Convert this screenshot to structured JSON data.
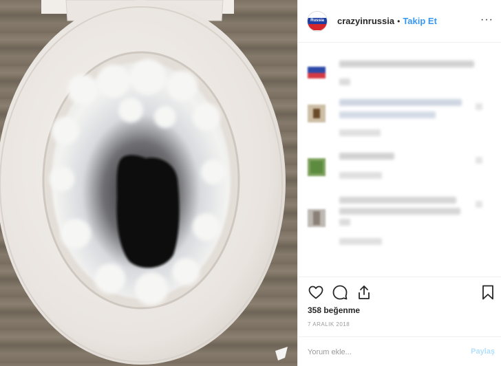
{
  "post": {
    "username": "crazyinrussia",
    "separator": "•",
    "follow_label": "Takip Et",
    "more_label": "···",
    "avatar_text": "Russia",
    "likes": "358 beğenme",
    "date": "7 ARALIK 2018"
  },
  "comment_form": {
    "placeholder": "Yorum ekle...",
    "post_label": "Paylaş"
  },
  "icons": {
    "like": "heart-icon",
    "comment": "comment-icon",
    "share": "share-icon",
    "save": "bookmark-icon",
    "more": "more-options-icon"
  },
  "colors": {
    "link_blue": "#3897f0",
    "post_disabled": "#b2dffc",
    "muted": "#999999",
    "text": "#262626"
  }
}
